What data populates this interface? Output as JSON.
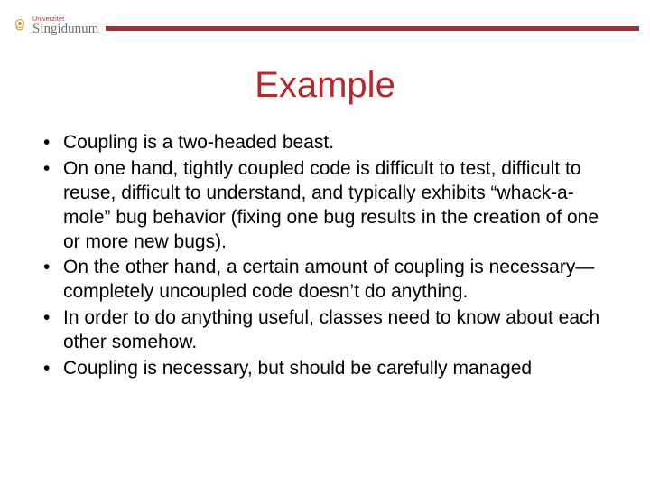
{
  "logo": {
    "university_label": "Univerzitet",
    "name": "Singidunum"
  },
  "title": "Example",
  "bullets": [
    "Coupling is a two-headed beast.",
    "On one hand, tightly coupled code is difficult to test, difficult to reuse, difficult to understand, and typically exhibits “whack-a-mole” bug behavior (fixing one bug results in the creation of one or more new bugs).",
    "On the other hand, a certain amount of coupling is necessary—completely uncoupled code doesn’t do anything.",
    "In order to do anything useful, classes need to know about each other somehow.",
    "Coupling is necessary, but should be carefully managed"
  ]
}
